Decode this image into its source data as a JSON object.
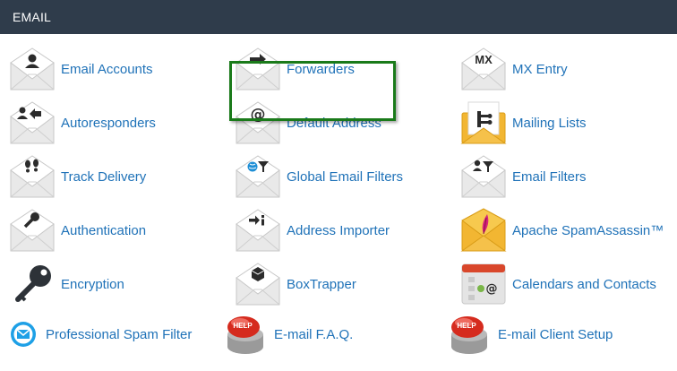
{
  "section": {
    "title": "EMAIL"
  },
  "rows": [
    [
      {
        "label": "Email Accounts",
        "icon": "envelope-person-icon"
      },
      {
        "label": "Forwarders",
        "icon": "envelope-arrow-right-icon"
      },
      {
        "label": "MX Entry",
        "icon": "envelope-mx-icon"
      }
    ],
    [
      {
        "label": "Autoresponders",
        "icon": "envelope-reply-person-icon"
      },
      {
        "label": "Default Address",
        "icon": "envelope-at-icon"
      },
      {
        "label": "Mailing Lists",
        "icon": "envelope-list-icon"
      }
    ],
    [
      {
        "label": "Track Delivery",
        "icon": "envelope-footprints-icon"
      },
      {
        "label": "Global Email Filters",
        "icon": "envelope-globe-filter-icon"
      },
      {
        "label": "Email Filters",
        "icon": "envelope-person-filter-icon"
      }
    ],
    [
      {
        "label": "Authentication",
        "icon": "envelope-key-icon"
      },
      {
        "label": "Address Importer",
        "icon": "envelope-import-icon"
      },
      {
        "label": "Apache SpamAssassin™",
        "icon": "envelope-feather-icon"
      }
    ],
    [
      {
        "label": "Encryption",
        "icon": "key-icon"
      },
      {
        "label": "BoxTrapper",
        "icon": "envelope-box-icon"
      },
      {
        "label": "Calendars and Contacts",
        "icon": "calendar-contacts-icon"
      }
    ],
    [
      {
        "label": "Professional Spam Filter",
        "icon": "spam-filter-shield-icon"
      },
      {
        "label": "E-mail F.A.Q.",
        "icon": "help-button-icon"
      },
      {
        "label": "E-mail Client Setup",
        "icon": "help-button-icon"
      }
    ]
  ],
  "help_badge_text": "HELP",
  "mx_badge_text": "MX",
  "colors": {
    "header_bg": "#2f3c4b",
    "link": "#1f72b8",
    "highlight_border": "#1a7a1a"
  }
}
